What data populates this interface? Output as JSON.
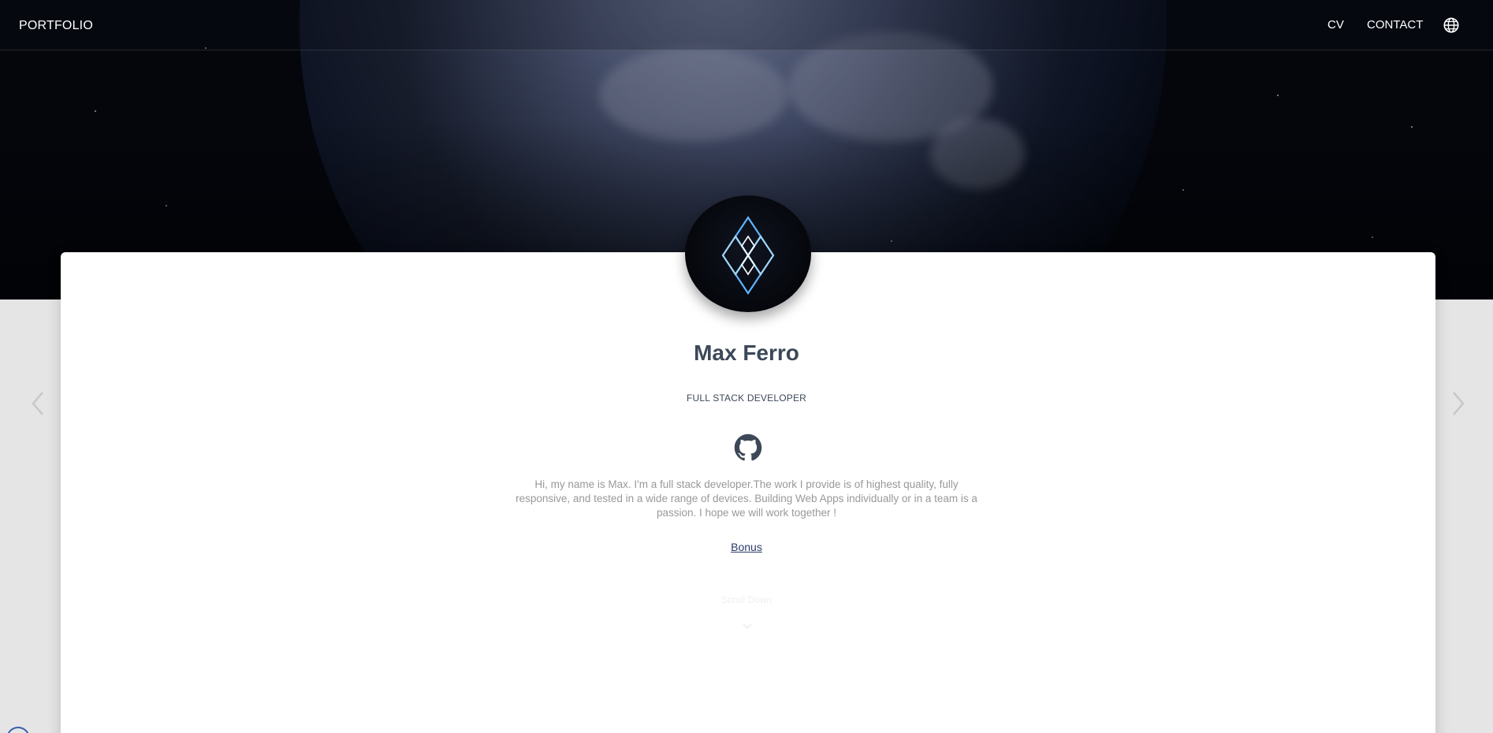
{
  "navbar": {
    "brand": "PORTFOLIO",
    "links": [
      "CV",
      "CONTACT"
    ],
    "language_icon": "globe-icon"
  },
  "profile": {
    "name": "Max Ferro",
    "role": "FULL STACK DEVELOPER",
    "github_icon": "github-icon",
    "bio": "Hi, my name is Max. I'm a full stack developer.The work I provide is of highest quality, fully responsive, and tested in a wide range of devices. Building Web Apps individually or in a team is a passion. I hope we will work together !",
    "bonus_link": "Bonus",
    "scroll_hint": "Scroll Down"
  },
  "carousel": {
    "prev_icon": "chevron-left-icon",
    "next_icon": "chevron-right-icon"
  },
  "colors": {
    "heading": "#3c4858",
    "body_text": "#999999",
    "link": "#2a3a6a",
    "page_bg": "#e5e5e5",
    "card_bg": "#ffffff"
  }
}
